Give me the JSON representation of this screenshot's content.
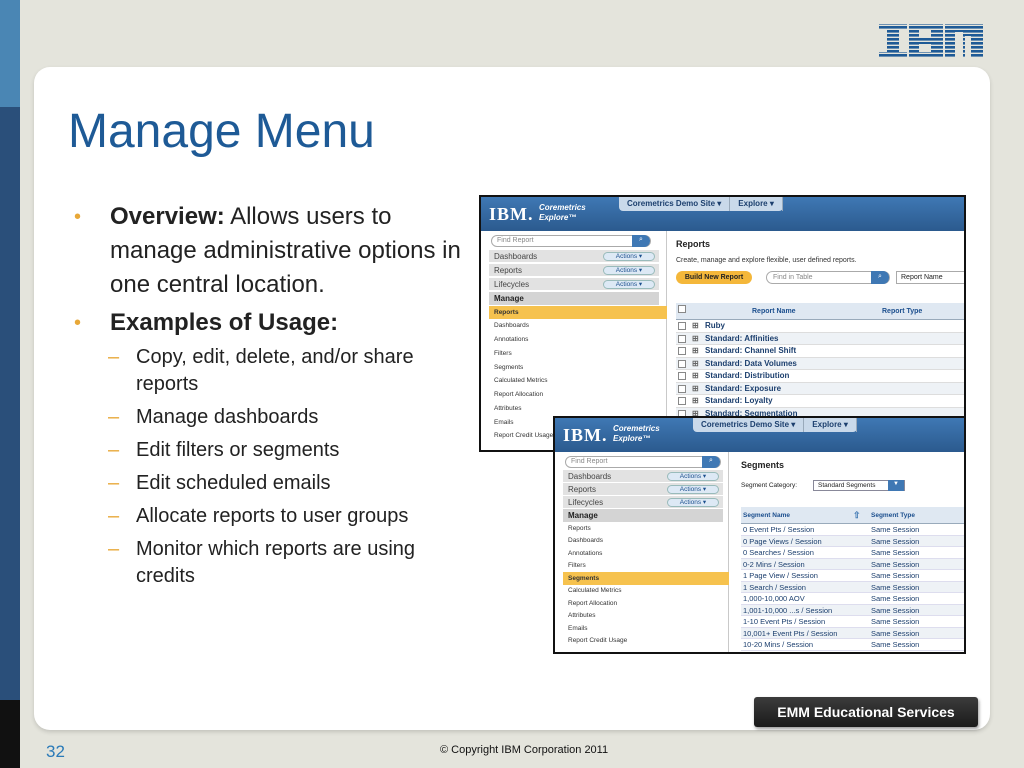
{
  "slide": {
    "title": "Manage Menu",
    "page_number": "32",
    "copyright": "© Copyright IBM Corporation 2011",
    "footer_badge": "EMM Educational Services",
    "logo_text": "IBM"
  },
  "bullets": {
    "overview_label": "Overview:",
    "overview_text": " Allows users to manage administrative options in one central location.",
    "examples_label": "Examples of Usage:",
    "sub": [
      "Copy, edit, delete, and/or share reports",
      "Manage dashboards",
      "Edit filters or segments",
      "Edit scheduled emails",
      "Allocate reports to user groups",
      "Monitor which reports are using credits"
    ]
  },
  "shot1": {
    "ibm": "IBM.",
    "brand_line1": "Coremetrics",
    "brand_line2": "Explore™",
    "tab_site": "Coremetrics Demo Site ▾",
    "tab_explore": "Explore ▾",
    "find_placeholder": "Find Report",
    "rows": [
      "Dashboards",
      "Reports",
      "Lifecycles"
    ],
    "actions_label": "Actions ▾",
    "manage": "Manage",
    "items": [
      "Reports",
      "Dashboards",
      "Annotations",
      "Filters",
      "Segments",
      "Calculated Metrics",
      "Report Allocation",
      "Attributes",
      "Emails",
      "Report Credit Usage"
    ],
    "main_title": "Reports",
    "main_desc": "Create, manage and explore flexible, user defined reports.",
    "build_button": "Build New Report",
    "find_table_placeholder": "Find in Table",
    "select_value": "Report Name",
    "col_name": "Report Name",
    "col_type": "Report Type",
    "reports": [
      "Ruby",
      "Standard: Affinities",
      "Standard: Channel Shift",
      "Standard: Data Volumes",
      "Standard: Distribution",
      "Standard: Exposure",
      "Standard: Loyalty",
      "Standard: Segmentation"
    ]
  },
  "shot2": {
    "ibm": "IBM.",
    "brand_line1": "Coremetrics",
    "brand_line2": "Explore™",
    "tab_site": "Coremetrics Demo Site ▾",
    "tab_explore": "Explore ▾",
    "find_placeholder": "Find Report",
    "rows": [
      "Dashboards",
      "Reports",
      "Lifecycles"
    ],
    "actions_label": "Actions ▾",
    "manage": "Manage",
    "items": [
      "Reports",
      "Dashboards",
      "Annotations",
      "Filters",
      "Segments",
      "Calculated Metrics",
      "Report Allocation",
      "Attributes",
      "Emails",
      "Report Credit Usage"
    ],
    "main_title": "Segments",
    "category_label": "Segment Category:",
    "category_value": "Standard Segments",
    "col_name": "Segment Name",
    "col_type": "Segment Type",
    "segments": [
      [
        "0 Event Pts / Session",
        "Same Session"
      ],
      [
        "0 Page Views / Session",
        "Same Session"
      ],
      [
        "0 Searches / Session",
        "Same Session"
      ],
      [
        "0-2 Mins / Session",
        "Same Session"
      ],
      [
        "1 Page View / Session",
        "Same Session"
      ],
      [
        "1 Search / Session",
        "Same Session"
      ],
      [
        "1,000-10,000 AOV",
        "Same Session"
      ],
      [
        "1,001-10,000 ...s / Session",
        "Same Session"
      ],
      [
        "1-10 Event Pts / Session",
        "Same Session"
      ],
      [
        "10,001+ Event Pts / Session",
        "Same Session"
      ],
      [
        "10-20 Mins / Session",
        "Same Session"
      ]
    ]
  },
  "colors": {
    "title_blue": "#1e5a96",
    "bullet_orange": "#e8a838",
    "highlight": "#f6c24e"
  }
}
